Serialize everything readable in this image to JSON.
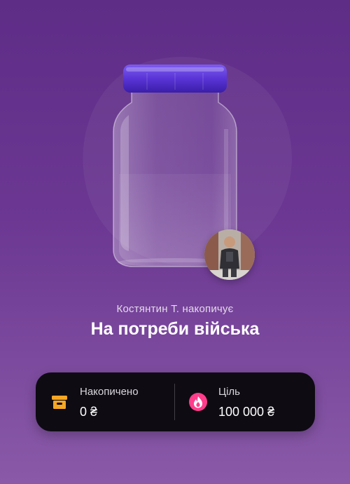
{
  "jar": {
    "owner_text": "Костянтин Т. накопичує",
    "title": "На потреби війська"
  },
  "icons": {
    "jar": "jar-icon",
    "avatar": "avatar-photo",
    "saved": "archive-box-icon",
    "goal": "flame-icon"
  },
  "stats": {
    "saved_label": "Накопичено",
    "saved_value": "0 ₴",
    "goal_label": "Ціль",
    "goal_value": "100 000 ₴"
  },
  "colors": {
    "background": "#6b3792",
    "lid": "#6a3fe0",
    "card": "#0e0b12",
    "saved_icon": "#f5a623",
    "goal_icon": "#ff3d8b"
  }
}
